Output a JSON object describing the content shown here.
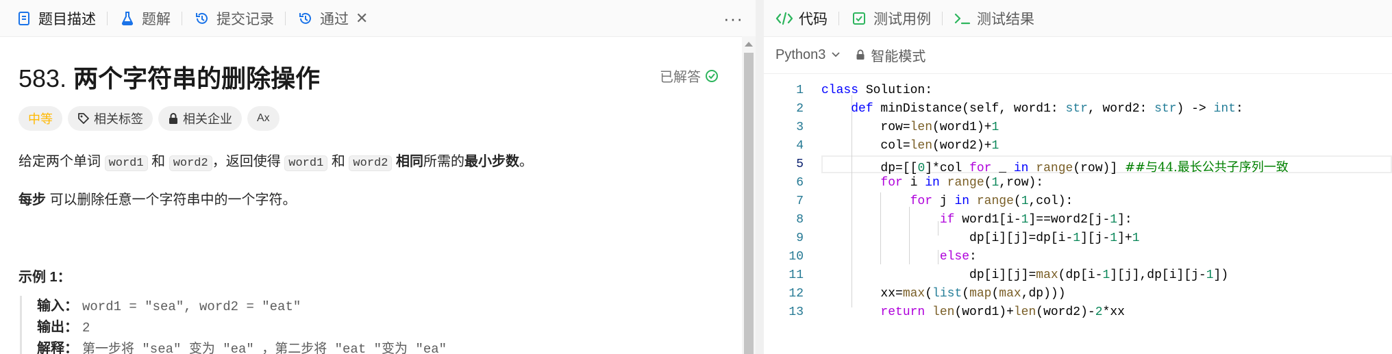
{
  "left_tabs": [
    {
      "label": "题目描述",
      "icon": "description-icon"
    },
    {
      "label": "题解",
      "icon": "flask-icon"
    },
    {
      "label": "提交记录",
      "icon": "history-icon"
    },
    {
      "label": "通过",
      "icon": "history-icon"
    }
  ],
  "right_tabs": [
    {
      "label": "代码",
      "icon": "code-icon"
    },
    {
      "label": "测试用例",
      "icon": "checkbox-icon"
    },
    {
      "label": "测试结果",
      "icon": "terminal-icon"
    }
  ],
  "problem": {
    "number": "583.",
    "title": "两个字符串的删除操作",
    "status": "已解答",
    "tags": [
      "中等",
      "相关标签",
      "相关企业",
      "Ax"
    ],
    "desc": {
      "p1": "给定两个单词",
      "c1": "word1",
      "p2": "和",
      "c2": "word2",
      "p3": "，返回使得",
      "c3": "word1",
      "p4": "和",
      "c4": "word2",
      "b1": "相同",
      "p5": "所需的",
      "b2": "最小步数",
      "p6": "。"
    },
    "note": {
      "bold": "每步",
      "text": "可以删除任意一个字符串中的一个字符。"
    },
    "example_title": "示例 1：",
    "example": {
      "input_label": "输入：",
      "input": "word1 = \"sea\", word2 = \"eat\"",
      "output_label": "输出：",
      "output": "2",
      "explain_label": "解释：",
      "explain": "第一步将 \"sea\" 变为 \"ea\" ，第二步将 \"eat \"变为 \"ea\""
    }
  },
  "editor": {
    "language": "Python3",
    "mode": "智能模式",
    "current_line": 5,
    "code_lines": [
      "class Solution:",
      "    def minDistance(self, word1: str, word2: str) -> int:",
      "        row=len(word1)+1",
      "        col=len(word2)+1",
      "        dp=[[0]*col for _ in range(row)] ##与44.最长公共子序列一致",
      "        for i in range(1,row):",
      "            for j in range(1,col):",
      "                if word1[i-1]==word2[j-1]:",
      "                    dp[i][j]=dp[i-1][j-1]+1",
      "                else:",
      "                    dp[i][j]=max(dp[i-1][j],dp[i][j-1])",
      "        xx=max(list(map(max,dp)))",
      "        return len(word1)+len(word2)-2*xx"
    ]
  },
  "colors": {
    "difficulty_medium": "#ffb800",
    "solved_check": "#2db55d",
    "code_tab_icon": "#2db55d",
    "keyword": "#0000ff",
    "type": "#267f99",
    "number": "#098658",
    "comment": "#008000",
    "line_number": "#237893"
  }
}
